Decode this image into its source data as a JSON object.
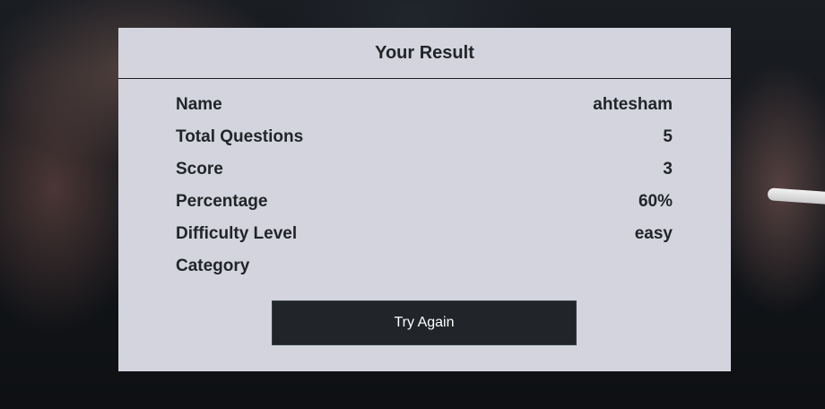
{
  "result": {
    "title": "Your Result",
    "rows": [
      {
        "label": "Name",
        "value": "ahtesham"
      },
      {
        "label": "Total Questions",
        "value": "5"
      },
      {
        "label": "Score",
        "value": "3"
      },
      {
        "label": "Percentage",
        "value": "60%"
      },
      {
        "label": "Difficulty Level",
        "value": "easy"
      },
      {
        "label": "Category",
        "value": ""
      }
    ],
    "button_label": "Try Again"
  },
  "colors": {
    "card_background": "#d3d4de",
    "button_background": "#212529",
    "text": "#212529"
  }
}
